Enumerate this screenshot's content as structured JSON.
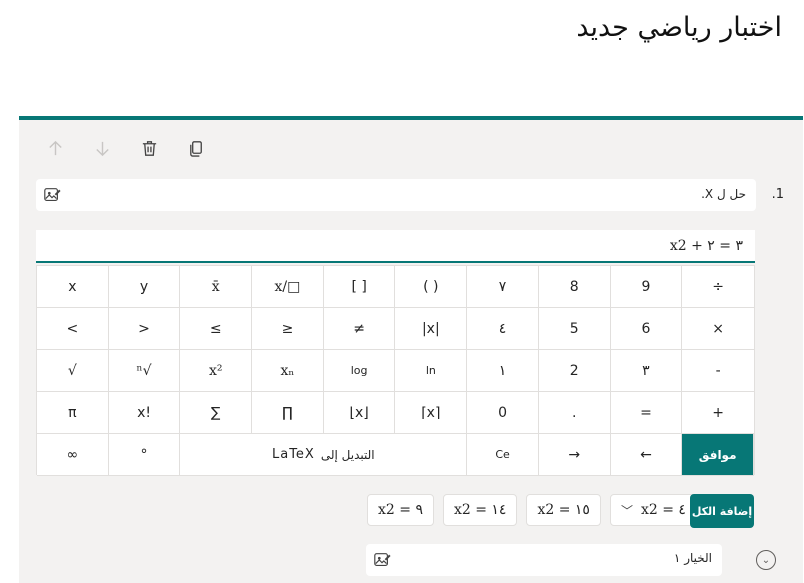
{
  "page": {
    "title": "اختبار رياضي جديد"
  },
  "toolbar": {
    "move_up": "move-up",
    "move_down": "move-down",
    "delete": "delete",
    "copy": "copy"
  },
  "question": {
    "number": "1.",
    "text": "حل ل X."
  },
  "math_input": {
    "value": "x2 + ٣ = ٢"
  },
  "keypad": {
    "keys": [
      "x",
      "y",
      "x̄",
      "x/□",
      "[ ]",
      "( )",
      "٧",
      "8",
      "9",
      "÷",
      "<",
      ">",
      "≤",
      "≥",
      "≠",
      "|x|",
      "٤",
      "5",
      "6",
      "×",
      "√",
      "ⁿ√",
      "x²",
      "xₙ",
      "log",
      "ln",
      "١",
      "2",
      "٣",
      "-",
      "π",
      "x!",
      "∑",
      "∏",
      "⌊x⌋",
      "⌈x⌉",
      "0",
      ".",
      "=",
      "+",
      "∞",
      "°",
      "",
      "",
      "",
      "",
      "Ce",
      "→",
      "←",
      "موافق"
    ],
    "switch_label": "التبديل إلى",
    "switch_target": "LaTeX",
    "ok": "موافق",
    "ce": "Ce"
  },
  "suggestions": [
    "x2 = ٩",
    "x2 = ١٤",
    "x2 = ١٥",
    "x2 = ٤"
  ],
  "add_all_label": "إضافة الكل",
  "option": {
    "placeholder": "الخيار ١"
  },
  "colors": {
    "accent": "#077776",
    "card_bg": "#f3f2f1"
  }
}
